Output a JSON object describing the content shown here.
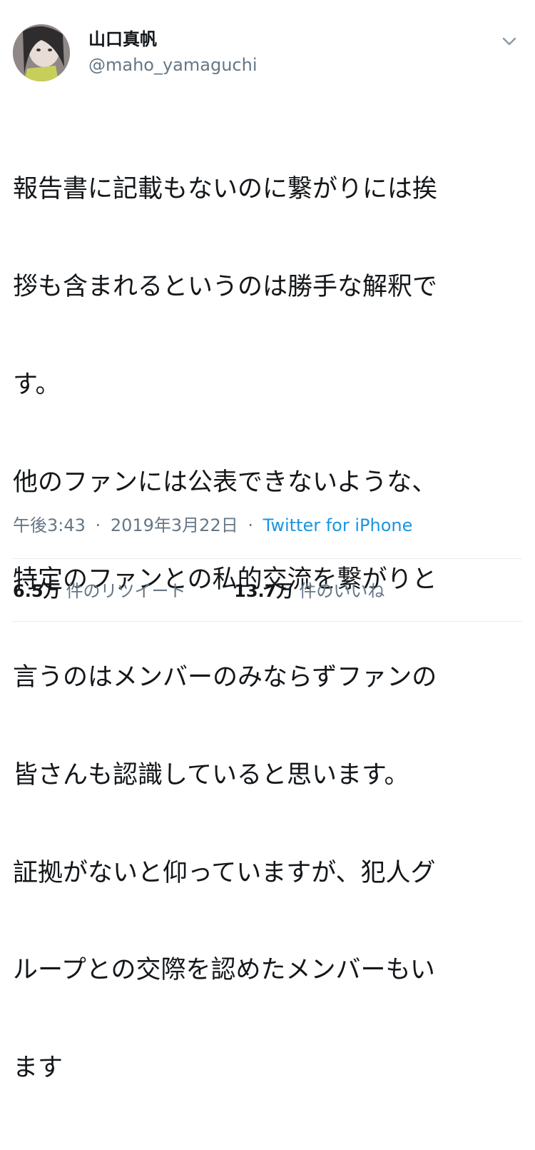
{
  "user": {
    "display_name": "山口真帆",
    "handle": "@maho_yamaguchi"
  },
  "icons": {
    "menu": "chevron-down-icon",
    "avatar": "avatar-image"
  },
  "tweet": {
    "lines": [
      "報告書に記載もないのに繋がりには挨",
      "拶も含まれるというのは勝手な解釈で",
      "す。",
      "他のファンには公表できないような、",
      "特定のファンとの私的交流を繋がりと",
      "言うのはメンバーのみならずファンの",
      "皆さんも認識していると思います。",
      "証拠がないと仰っていますが、犯人グ",
      "ループとの交際を認めたメンバーもい",
      "ます"
    ]
  },
  "meta": {
    "time": "午後3:43",
    "separator": "·",
    "date": "2019年3月22日",
    "source": "Twitter for iPhone"
  },
  "stats": {
    "retweets_count": "6.5万",
    "retweets_label": "件のリツイート",
    "likes_count": "13.7万",
    "likes_label": "件のいいね"
  },
  "colors": {
    "text": "#14171a",
    "secondary": "#657786",
    "link": "#1b95e0",
    "divider": "#e6ecf0"
  }
}
